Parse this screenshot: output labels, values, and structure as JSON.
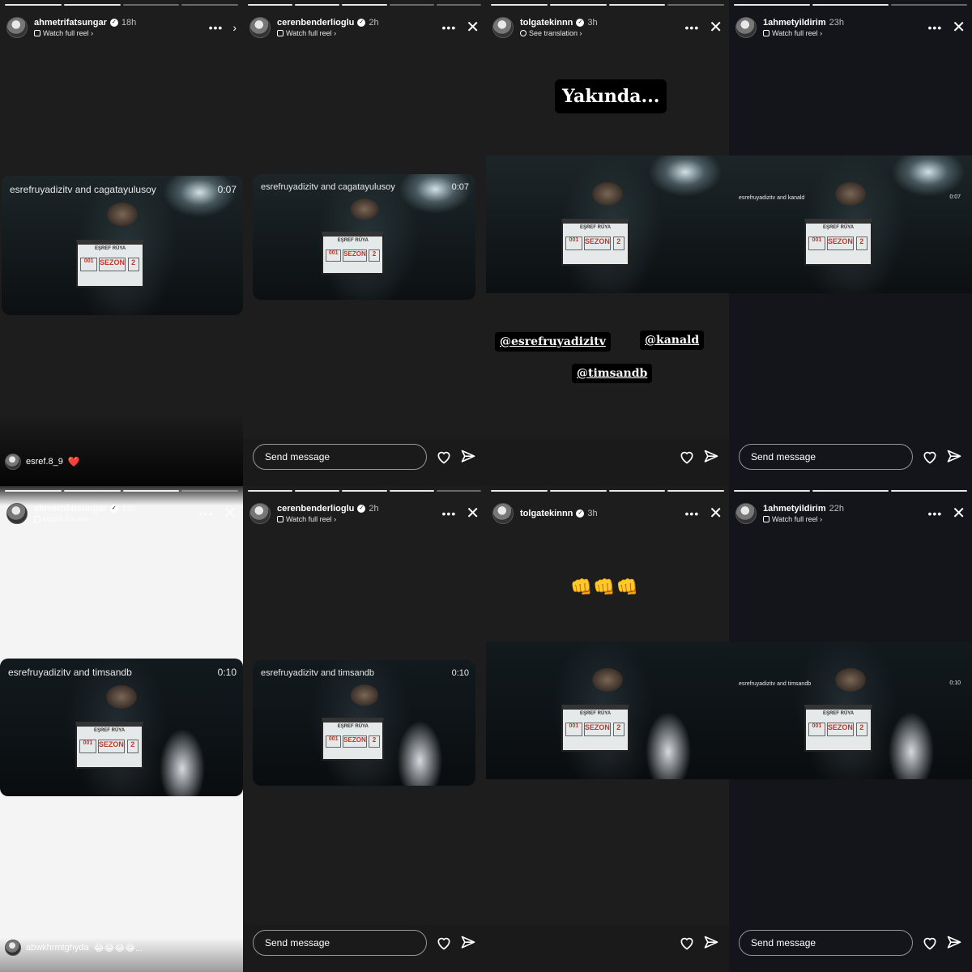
{
  "panels": [
    {
      "username": "ahmetrifatsungar",
      "time": "18h",
      "subtitle": "Watch full reel ›",
      "video_label": "esrefruyadizitv and cagatayulusoy",
      "duration": "0:07",
      "comment_user": "esref.8_9",
      "comment_emoji": "❤️"
    },
    {
      "username": "cerenbenderlioglu",
      "time": "2h",
      "subtitle": "Watch full reel ›",
      "video_label": "esrefruyadizitv and cagatayulusoy",
      "duration": "0:07",
      "message_placeholder": "Send message"
    },
    {
      "username": "tolgatekinnn",
      "time": "3h",
      "subtitle": "See translation ›",
      "sticker_text": "Yakında...",
      "mentions": [
        "@esrefruyadizitv",
        "@kanald",
        "@timsandb"
      ]
    },
    {
      "username": "1ahmetyildirim",
      "time": "23h",
      "subtitle": "Watch full reel ›",
      "video_label": "esrefruyadizitv and kanald",
      "duration": "0:07",
      "message_placeholder": "Send message"
    },
    {
      "username": "ahmetrifatsungar",
      "time": "18h",
      "subtitle": "Watch full reel ›",
      "video_label": "esrefruyadizitv and timsandb",
      "duration": "0:10",
      "comment_user": "abwkhrmtghyda",
      "comment_emoji": "😂😂😂😂..."
    },
    {
      "username": "cerenbenderlioglu",
      "time": "2h",
      "subtitle": "Watch full reel ›",
      "video_label": "esrefruyadizitv and timsandb",
      "duration": "0:10",
      "message_placeholder": "Send message"
    },
    {
      "username": "tolgatekinnn",
      "time": "3h",
      "emoji_text": "👊👊👊"
    },
    {
      "username": "1ahmetyildirim",
      "time": "22h",
      "subtitle": "Watch full reel ›",
      "video_label": "esrefruyadizitv and timsandb",
      "duration": "0:10",
      "message_placeholder": "Send message"
    }
  ],
  "slate": {
    "title": "EŞREF RÜYA",
    "episode": "001",
    "season": "SEZON",
    "number": "2"
  },
  "icons": [
    "reel-icon",
    "globe-icon",
    "more-icon",
    "close-icon",
    "heart-icon",
    "send-icon",
    "verified-icon"
  ],
  "colors": {
    "background": "#1d1d1d",
    "heart": "#e0202f",
    "text": "#ffffff"
  }
}
